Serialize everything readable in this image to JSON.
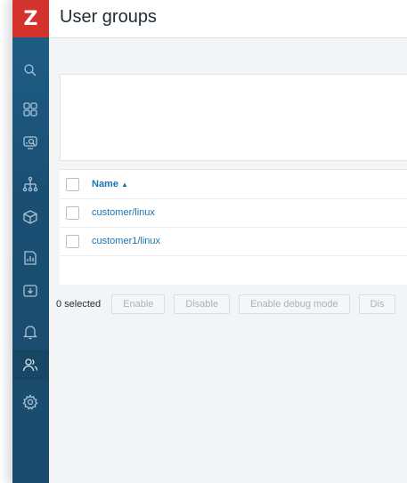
{
  "app": {
    "logo_text": "Z",
    "brand_color": "#d4322c",
    "sidebar_color": "#1a4f73"
  },
  "page": {
    "title": "User groups"
  },
  "sidebar": {
    "items": [
      {
        "icon": "search-icon"
      },
      {
        "icon": "dashboard-icon"
      },
      {
        "icon": "monitoring-icon"
      },
      {
        "icon": "network-icon"
      },
      {
        "icon": "inventory-cube-icon"
      },
      {
        "icon": "reports-icon"
      },
      {
        "icon": "data-collection-icon"
      },
      {
        "icon": "alerts-bell-icon"
      },
      {
        "icon": "users-icon",
        "active": true
      },
      {
        "icon": "settings-gear-icon"
      }
    ]
  },
  "table": {
    "header": {
      "name_label": "Name",
      "sort_indicator": "▲"
    },
    "rows": [
      {
        "name": "customer/linux"
      },
      {
        "name": "customer1/linux"
      }
    ]
  },
  "actions": {
    "selected_count": "0 selected",
    "enable_label": "Enable",
    "disable_label": "Disable",
    "enable_debug_label": "Enable debug mode",
    "disable_debug_label": "Dis"
  }
}
